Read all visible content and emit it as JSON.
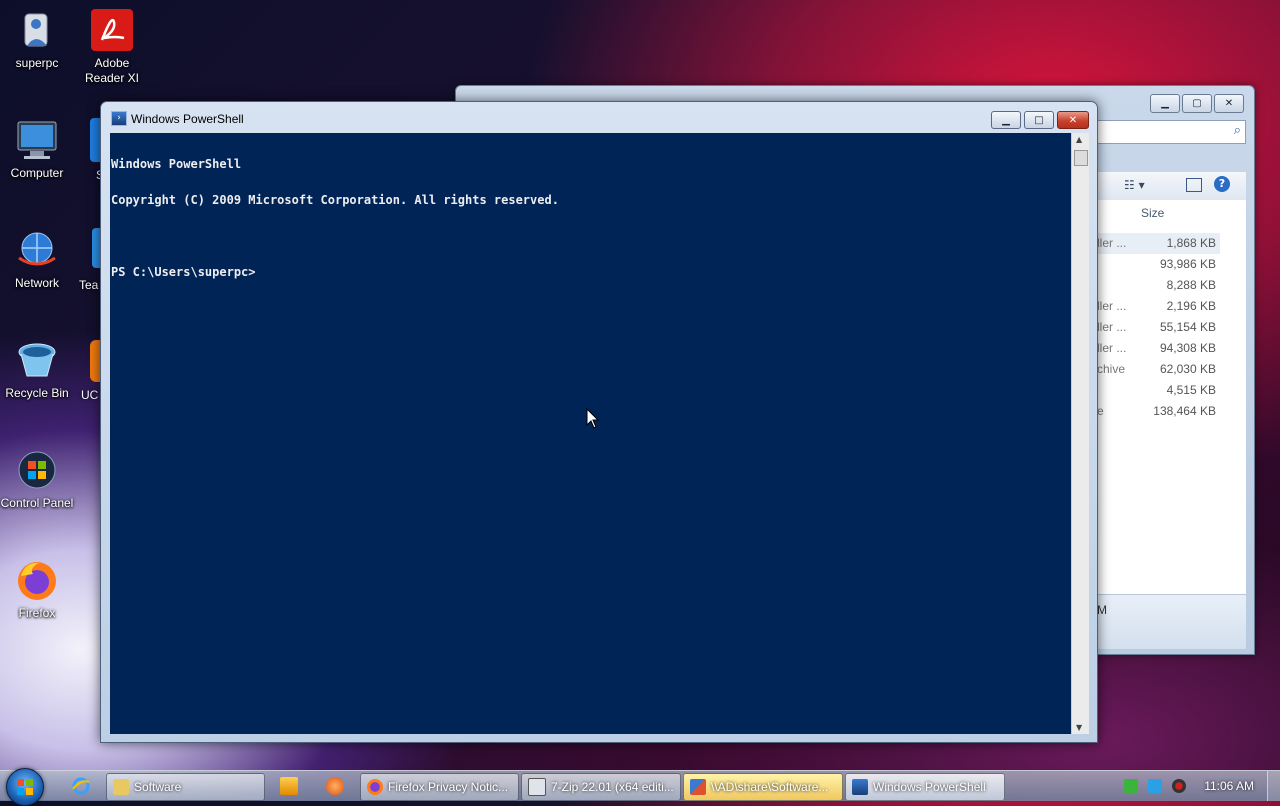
{
  "desktop": {
    "icons": [
      {
        "label": "superpc"
      },
      {
        "label": "Adobe Reader XI"
      },
      {
        "label": "Computer"
      },
      {
        "label": "Network"
      },
      {
        "label": "Recycle Bin"
      },
      {
        "label": "Control Panel"
      },
      {
        "label": "Firefox"
      }
    ],
    "partial_labels": [
      "S",
      "Tea",
      "UC"
    ]
  },
  "explorer": {
    "column_header": "Size",
    "rows": [
      {
        "name": "ller ...",
        "size": "1,868 KB"
      },
      {
        "name": "",
        "size": "93,986 KB"
      },
      {
        "name": "",
        "size": "8,288 KB"
      },
      {
        "name": "ller ...",
        "size": "2,196 KB"
      },
      {
        "name": "ller ...",
        "size": "55,154 KB"
      },
      {
        "name": "ller ...",
        "size": "94,308 KB"
      },
      {
        "name": "chive",
        "size": "62,030 KB"
      },
      {
        "name": "",
        "size": "4,515 KB"
      },
      {
        "name": "e",
        "size": "138,464 KB"
      }
    ],
    "status_fragment": "M"
  },
  "powershell": {
    "title": "Windows PowerShell",
    "lines": [
      "Windows PowerShell",
      "Copyright (C) 2009 Microsoft Corporation. All rights reserved.",
      "",
      "PS C:\\Users\\superpc>"
    ],
    "buttons": {
      "minimize": "▁",
      "maximize": "□",
      "close": "✕"
    }
  },
  "taskbar": {
    "items": [
      {
        "label": "Software"
      },
      {
        "label": "Firefox Privacy Notic..."
      },
      {
        "label": "7-Zip 22.01 (x64 editi..."
      },
      {
        "label": "\\\\AD\\share\\Software..."
      },
      {
        "label": "Windows PowerShell"
      }
    ],
    "clock": "11:06 AM"
  },
  "colors": {
    "console_bg": "#012456",
    "console_fg": "#eeedf0",
    "close_red": "#c8432d"
  }
}
